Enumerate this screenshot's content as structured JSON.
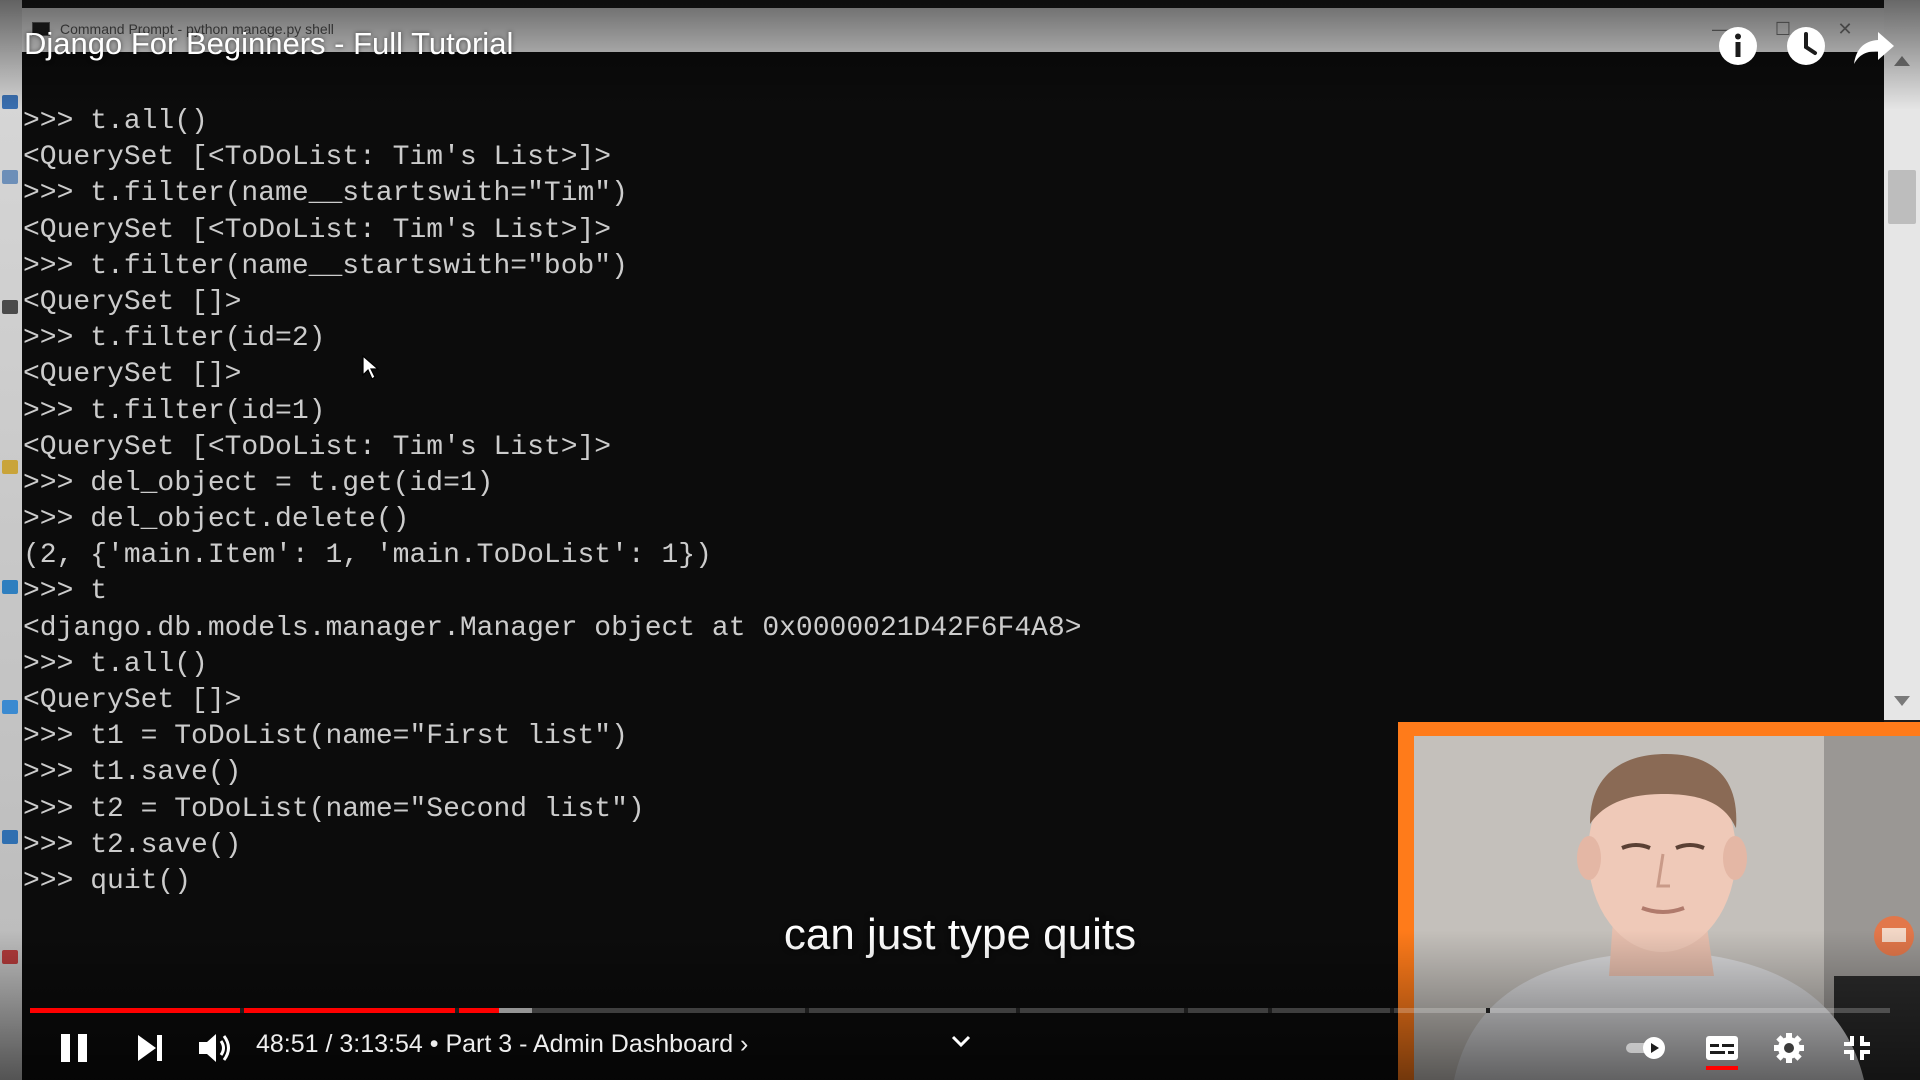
{
  "window": {
    "title": "Command Prompt - python  manage.py shell",
    "minimize_glyph": "—",
    "maximize_glyph": "☐",
    "close_glyph": "✕"
  },
  "terminal": {
    "lines": [
      ">>> t.all()",
      "<QuerySet [<ToDoList: Tim's List>]>",
      ">>> t.filter(name__startswith=\"Tim\")",
      "<QuerySet [<ToDoList: Tim's List>]>",
      ">>> t.filter(name__startswith=\"bob\")",
      "<QuerySet []>",
      ">>> t.filter(id=2)",
      "<QuerySet []>",
      ">>> t.filter(id=1)",
      "<QuerySet [<ToDoList: Tim's List>]>",
      ">>> del_object = t.get(id=1)",
      ">>> del_object.delete()",
      "(2, {'main.Item': 1, 'main.ToDoList': 1})",
      ">>> t",
      "<django.db.models.manager.Manager object at 0x0000021D42F6F4A8>",
      ">>> t.all()",
      "<QuerySet []>",
      ">>> t1 = ToDoList(name=\"First list\")",
      ">>> t1.save()",
      ">>> t2 = ToDoList(name=\"Second list\")",
      ">>> t2.save()",
      ">>> quit()"
    ]
  },
  "player": {
    "video_title": "Django For Beginners - Full Tutorial",
    "caption": "can just type quits",
    "current_time": "48:51",
    "duration": "3:13:54",
    "time_display": "48:51 / 3:13:54 • Part 3 - Admin Dashboard ›",
    "chapter": "Part 3 - Admin Dashboard",
    "progress_fraction": 0.252,
    "loaded_fraction": 0.27,
    "autoplay": "on",
    "captions": "on"
  },
  "icons": {
    "info": "info-icon",
    "watch_later": "clock-icon",
    "share": "share-icon",
    "pause": "pause-icon",
    "next": "next-icon",
    "volume": "volume-icon",
    "settings": "gear-icon",
    "subtitles": "subtitles-icon",
    "exit_fullscreen": "exit-fullscreen-icon",
    "autoplay_toggle": "autoplay-toggle-icon",
    "chapter_chevron": "chevron-down-icon"
  },
  "colors": {
    "terminal_bg": "#0c0c0c",
    "terminal_text": "#cccccc",
    "progress_played": "#ff0000",
    "facecam_border": "#ff7b1a"
  }
}
